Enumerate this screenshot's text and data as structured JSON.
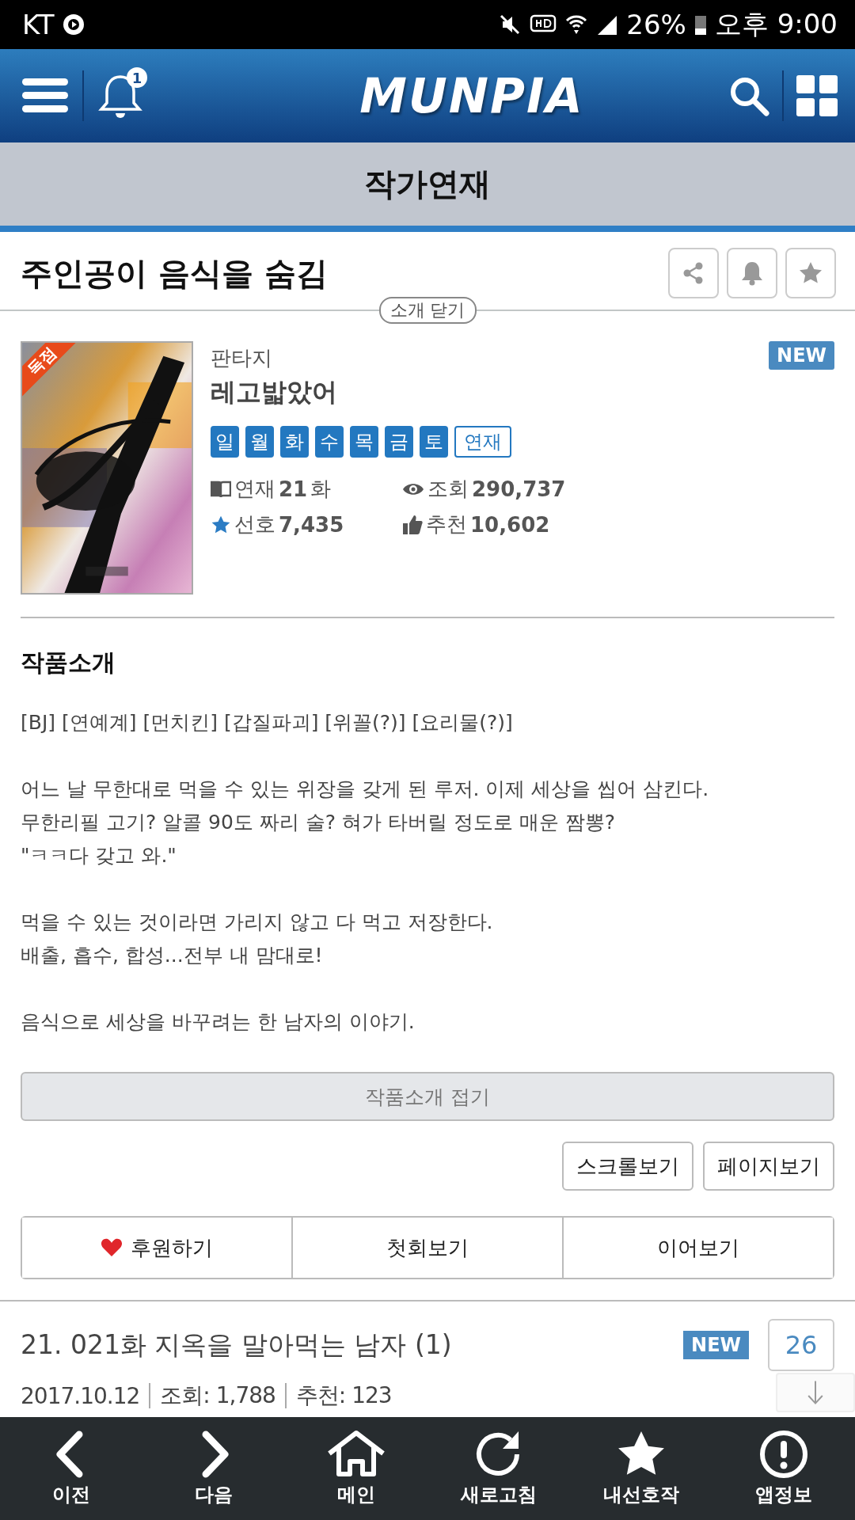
{
  "status_bar": {
    "carrier": "KT",
    "battery": "26%",
    "time": "오후 9:00"
  },
  "header": {
    "logo": "MUNPIA",
    "notification_count": "1"
  },
  "section_title": "작가연재",
  "work": {
    "title": "주인공이 음식을 숨김",
    "intro_toggle": "소개 닫기",
    "cover_badge": "독점",
    "genre": "판타지",
    "author": "레고밟았어",
    "new_badge": "NEW",
    "days": [
      {
        "label": "일",
        "on": true
      },
      {
        "label": "월",
        "on": true
      },
      {
        "label": "화",
        "on": true
      },
      {
        "label": "수",
        "on": true
      },
      {
        "label": "목",
        "on": true
      },
      {
        "label": "금",
        "on": true
      },
      {
        "label": "토",
        "on": true
      }
    ],
    "status": "연재",
    "stats": [
      {
        "kind": "book",
        "label": "연재",
        "value": "21",
        "unit": "화"
      },
      {
        "kind": "eye",
        "label": "조회",
        "value": "290,737"
      },
      {
        "kind": "star",
        "label": "선호",
        "value": "7,435"
      },
      {
        "kind": "thumb",
        "label": "추천",
        "value": "10,602"
      }
    ]
  },
  "intro": {
    "heading": "작품소개",
    "paragraphs": [
      [
        "[BJ] [연예계] [먼치킨] [갑질파괴] [위꼴(?)] [요리물(?)]"
      ],
      [
        "어느 날 무한대로 먹을 수 있는 위장을 갖게 된 루저. 이제 세상을 씹어 삼킨다.",
        "무한리필 고기? 알콜 90도 짜리 술? 혀가 타버릴 정도로 매운 짬뽕?",
        "\"ㅋㅋ다 갖고 와.\""
      ],
      [
        "먹을 수 있는 것이라면 가리지 않고 다 먹고 저장한다.",
        "배출, 흡수, 합성...전부 내 맘대로!"
      ],
      [
        "음식으로 세상을 바꾸려는 한 남자의 이야기."
      ]
    ],
    "fold_button": "작품소개 접기"
  },
  "view_buttons": [
    "스크롤보기",
    "페이지보기"
  ],
  "actions": [
    {
      "kind": "heart",
      "label": "후원하기"
    },
    {
      "kind": "plain",
      "label": "첫회보기"
    },
    {
      "kind": "plain",
      "label": "이어보기"
    }
  ],
  "episodes": [
    {
      "title": "21. 021화 지옥을 말아먹는 남자 (1)",
      "new": true,
      "new_label": "NEW",
      "comments": "26",
      "date": "2017.10.12",
      "views": "조회: 1,788",
      "recommends": "추천: 123"
    }
  ],
  "bottom_nav": [
    {
      "kind": "prev",
      "label": "이전"
    },
    {
      "kind": "next",
      "label": "다음"
    },
    {
      "kind": "home",
      "label": "메인"
    },
    {
      "kind": "refresh",
      "label": "새로고침"
    },
    {
      "kind": "star",
      "label": "내선호작"
    },
    {
      "kind": "info",
      "label": "앱정보"
    }
  ]
}
